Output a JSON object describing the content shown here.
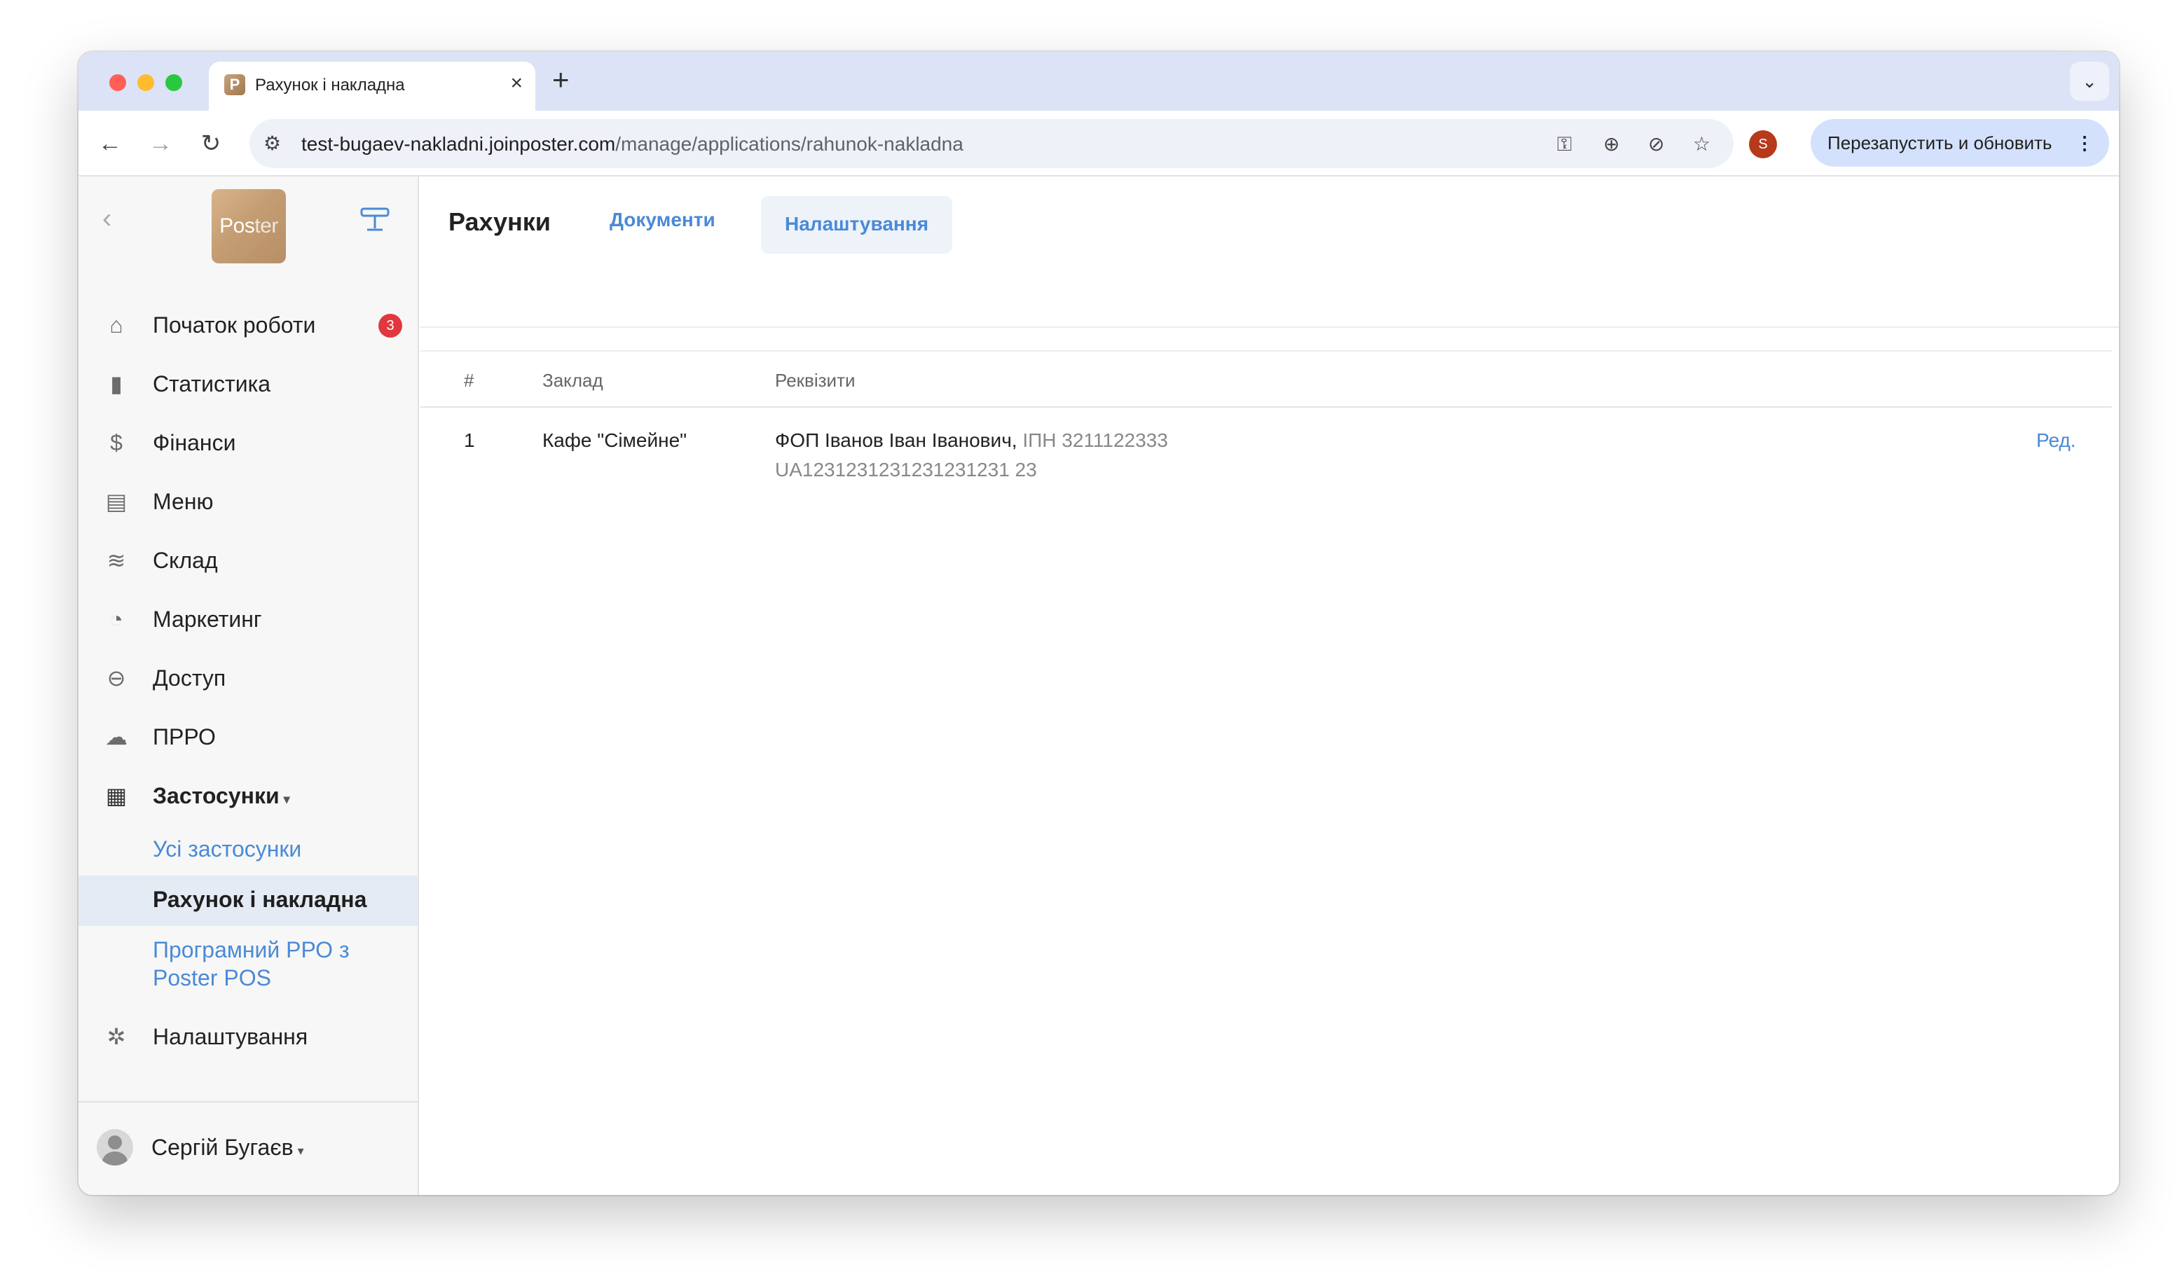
{
  "browser": {
    "tab_title": "Рахунок і накладна",
    "favicon_letter": "P",
    "url_host": "test-bugaev-nakladni.joinposter.com",
    "url_path": "/manage/applications/rahunok-nakladna",
    "profile_initial": "S",
    "relaunch_label": "Перезапустить и обновить"
  },
  "sidebar": {
    "logo_main": "Pos",
    "logo_light": "ter",
    "items": [
      {
        "label": "Початок роботи",
        "icon": "home-icon",
        "badge": "3"
      },
      {
        "label": "Статистика",
        "icon": "bar-chart-icon"
      },
      {
        "label": "Фінанси",
        "icon": "dollar-icon"
      },
      {
        "label": "Меню",
        "icon": "document-icon"
      },
      {
        "label": "Склад",
        "icon": "layers-icon"
      },
      {
        "label": "Маркетинг",
        "icon": "pie-chart-icon"
      },
      {
        "label": "Доступ",
        "icon": "lock-icon"
      },
      {
        "label": "ПРРО",
        "icon": "cloud-register-icon"
      },
      {
        "label": "Застосунки",
        "icon": "grid-icon",
        "caret": "▾"
      }
    ],
    "sub_items": [
      {
        "label": "Усі застосунки"
      },
      {
        "label": "Рахунок і накладна"
      },
      {
        "label": "Програмний РРО з Poster POS"
      }
    ],
    "settings_label": "Налаштування",
    "user_name": "Сергій Бугаєв",
    "user_caret": "▾"
  },
  "main": {
    "page_title": "Рахунки",
    "tabs": [
      {
        "label": "Документи"
      },
      {
        "label": "Налаштування"
      }
    ],
    "table": {
      "columns": [
        "#",
        "Заклад",
        "Реквізити"
      ],
      "rows": [
        {
          "num": "1",
          "venue": "Кафе \"Сімейне\"",
          "details_name": "ФОП Іванов Іван Іванович,",
          "details_tax": "ІПН 3211122333",
          "details_iban": "UA1231231231231231231 23",
          "edit_label": "Ред."
        }
      ]
    }
  },
  "colors": {
    "accent": "#4a8ad6",
    "badge": "#e0383e",
    "chat": "#4b7fd1"
  }
}
